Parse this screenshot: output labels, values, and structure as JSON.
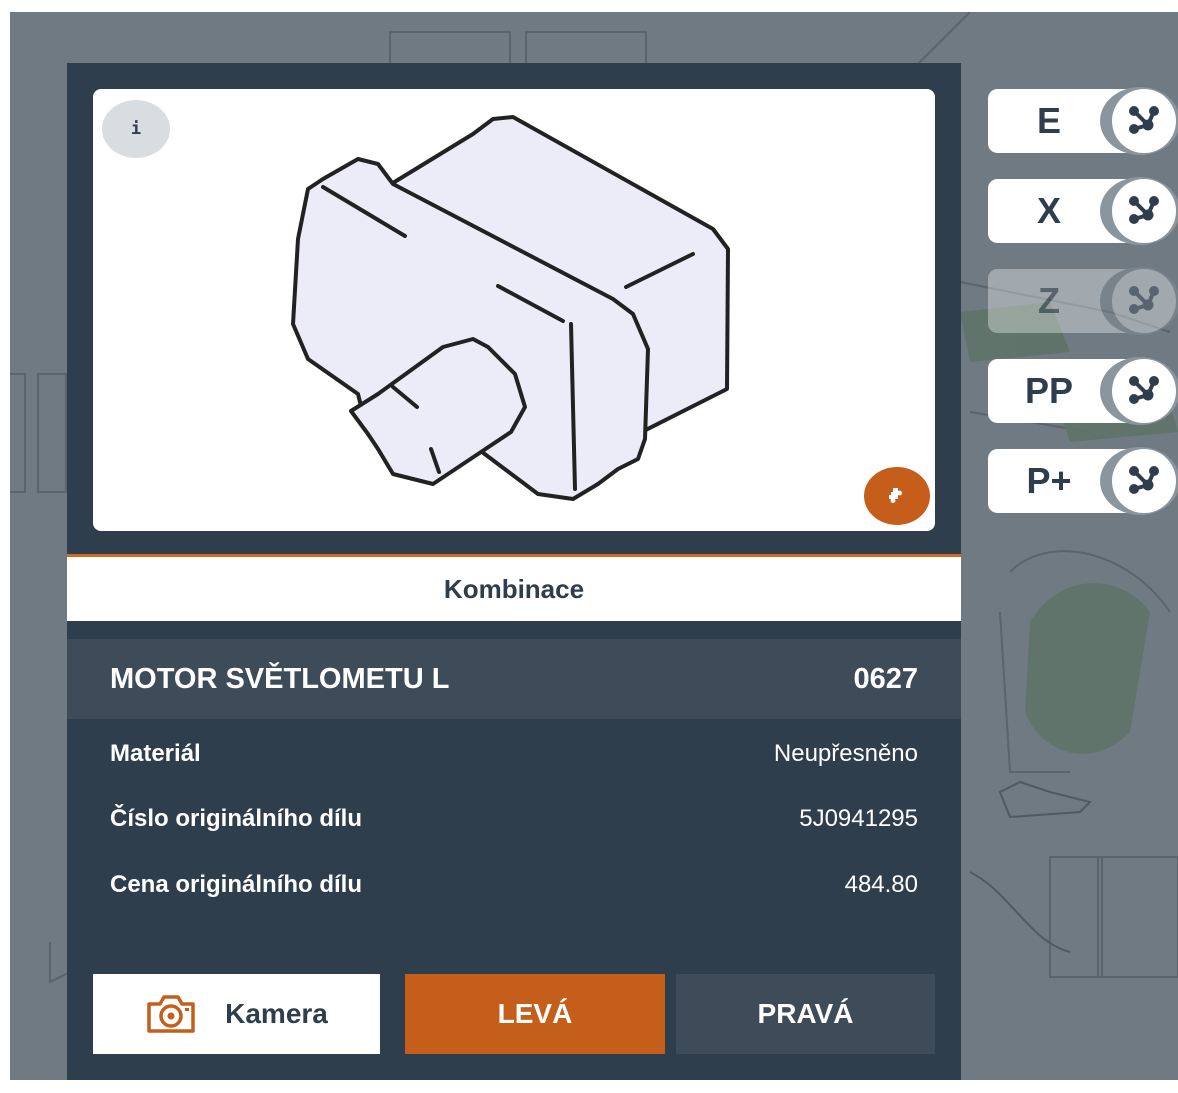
{
  "part": {
    "caption": "Kombinace",
    "name": "MOTOR SVĚTLOMETU L",
    "code": "0627",
    "properties": [
      {
        "label": "Materiál",
        "value": "Neupřesněno"
      },
      {
        "label": "Číslo originálního dílu",
        "value": "5J0941295"
      },
      {
        "label": "Cena originálního dílu",
        "value": "484.80"
      }
    ]
  },
  "image_card": {
    "info_label": "i",
    "info_icon": "info-icon",
    "combination_icon": "puzzle-icon"
  },
  "actions": {
    "camera_label": "Kamera",
    "camera_icon": "camera-icon",
    "left_label": "LEVÁ",
    "right_label": "PRAVÁ"
  },
  "side_buttons": [
    {
      "label": "E",
      "icon": "graph-nodes-icon",
      "enabled": true
    },
    {
      "label": "X",
      "icon": "graph-nodes-icon",
      "enabled": true
    },
    {
      "label": "Z",
      "icon": "graph-nodes-icon",
      "enabled": false
    },
    {
      "label": "PP",
      "icon": "graph-nodes-icon",
      "enabled": true
    },
    {
      "label": "P+",
      "icon": "graph-nodes-icon",
      "enabled": true
    }
  ],
  "colors": {
    "panel": "#2f3e4c",
    "panel_header": "#3e4c5a",
    "accent": "#c45e1a",
    "backdrop": "#6f7a83"
  }
}
